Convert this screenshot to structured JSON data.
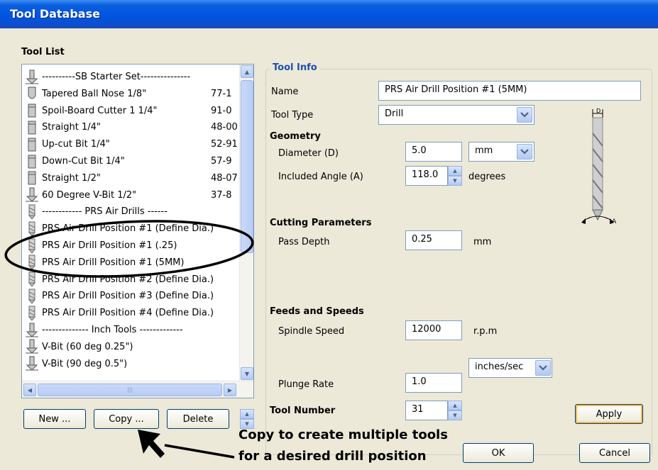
{
  "window": {
    "title": "Tool Database"
  },
  "tool_list": {
    "heading": "Tool List",
    "rows": [
      {
        "icon": "vbit-icon",
        "name": "----------SB Starter Set---------------",
        "id": ""
      },
      {
        "icon": "ball-nose-icon",
        "name": "Tapered Ball Nose 1/8\"",
        "id": "77-1"
      },
      {
        "icon": "end-mill-icon",
        "name": "Spoil-Board Cutter 1 1/4\"",
        "id": "91-0"
      },
      {
        "icon": "end-mill-icon",
        "name": "Straight 1/4\"",
        "id": "48-00"
      },
      {
        "icon": "end-mill-icon",
        "name": "Up-cut Bit 1/4\"",
        "id": "52-91"
      },
      {
        "icon": "end-mill-icon",
        "name": "Down-Cut Bit 1/4\"",
        "id": "57-9"
      },
      {
        "icon": "end-mill-icon",
        "name": "Straight 1/2\"",
        "id": "48-07"
      },
      {
        "icon": "vbit-icon",
        "name": "60 Degree V-Bit 1/2\"",
        "id": "37-8"
      },
      {
        "icon": "drill-icon",
        "name": "------------ PRS Air Drills ------",
        "id": ""
      },
      {
        "icon": "drill-icon",
        "name": "PRS Air Drill Position #1 (Define Dia.)",
        "id": ""
      },
      {
        "icon": "drill-icon",
        "name": "PRS Air Drill Position #1 (.25)",
        "id": ""
      },
      {
        "icon": "drill-icon",
        "name": "PRS Air Drill Position #1 (5MM)",
        "id": ""
      },
      {
        "icon": "drill-icon",
        "name": "PRS Air Drill Position #2 (Define Dia.)",
        "id": ""
      },
      {
        "icon": "drill-icon",
        "name": "PRS Air Drill Position #3 (Define Dia.)",
        "id": ""
      },
      {
        "icon": "drill-icon",
        "name": "PRS Air Drill Position #4 (Define Dia.)",
        "id": ""
      },
      {
        "icon": "vbit-icon",
        "name": "-------------- Inch Tools -------------",
        "id": ""
      },
      {
        "icon": "vbit-icon",
        "name": "V-Bit (60 deg 0.25\")",
        "id": ""
      },
      {
        "icon": "vbit-icon",
        "name": "V-Bit (90 deg 0.5\")",
        "id": ""
      }
    ],
    "buttons": {
      "new": "New ...",
      "copy": "Copy ...",
      "delete": "Delete"
    }
  },
  "tool_info": {
    "heading": "Tool Info",
    "name_label": "Name",
    "name_value": "PRS Air Drill Position #1 (5MM)",
    "type_label": "Tool Type",
    "type_value": "Drill",
    "geometry": {
      "heading": "Geometry",
      "diameter_label": "Diameter (D)",
      "diameter_value": "5.0",
      "diameter_unit": "mm",
      "angle_label": "Included Angle (A)",
      "angle_value": "118.0",
      "angle_unit": "degrees"
    },
    "diagram": {
      "d_label": "D",
      "a_label": "A"
    },
    "cutting": {
      "heading": "Cutting Parameters",
      "pass_depth_label": "Pass Depth",
      "pass_depth_value": "0.25",
      "pass_depth_unit": "mm"
    },
    "feeds": {
      "heading": "Feeds and Speeds",
      "spindle_label": "Spindle Speed",
      "spindle_value": "12000",
      "spindle_unit": "r.p.m",
      "plunge_label": "Plunge Rate",
      "plunge_value": "1.0",
      "plunge_unit": "inches/sec"
    },
    "tool_number_label": "Tool Number",
    "tool_number_value": "31",
    "apply": "Apply"
  },
  "dialog_buttons": {
    "ok": "OK",
    "cancel": "Cancel"
  },
  "annotation": {
    "line1": "Copy to create multiple tools",
    "line2": "for a desired drill position"
  }
}
